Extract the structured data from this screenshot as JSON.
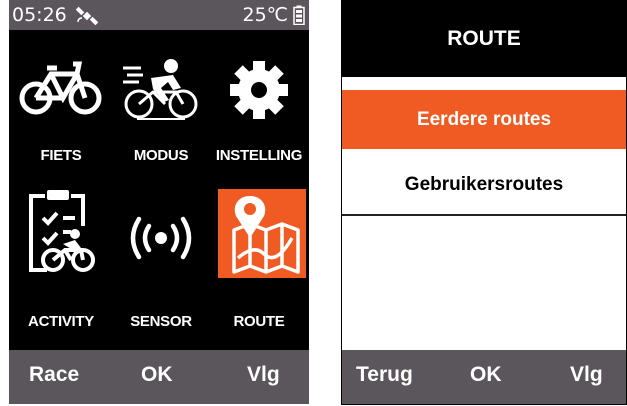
{
  "left_screen": {
    "status": {
      "time": "05:26",
      "temperature": "25℃",
      "gps_icon": "satellite-icon",
      "battery_icon": "battery-icon"
    },
    "tiles": [
      {
        "label": "FIETS",
        "icon": "bicycle-icon"
      },
      {
        "label": "MODUS",
        "icon": "cyclist-icon"
      },
      {
        "label": "INSTELLING",
        "icon": "gear-icon"
      },
      {
        "label": "ACTIVITY",
        "icon": "activity-icon"
      },
      {
        "label": "SENSOR",
        "icon": "sensor-icon"
      },
      {
        "label": "ROUTE",
        "icon": "route-map-icon",
        "selected": true
      }
    ],
    "buttons": {
      "left": "Race",
      "center": "OK",
      "right": "Vlg"
    }
  },
  "right_screen": {
    "title": "ROUTE",
    "items": [
      {
        "label": "Eerdere routes",
        "selected": true
      },
      {
        "label": "Gebruikersroutes",
        "selected": false
      }
    ],
    "buttons": {
      "left": "Terug",
      "center": "OK",
      "right": "Vlg"
    }
  },
  "colors": {
    "accent": "#ef5b23",
    "bar": "#5b565b",
    "background": "#000000"
  }
}
